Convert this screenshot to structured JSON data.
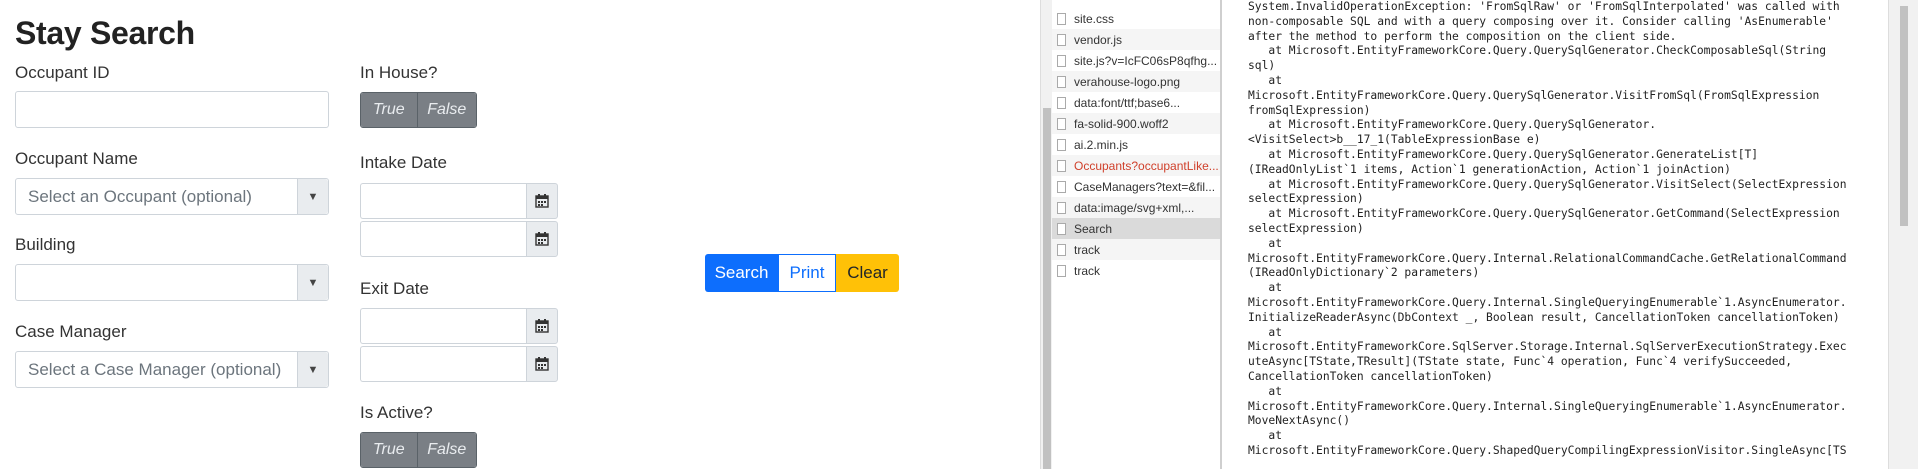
{
  "form": {
    "title": "Stay Search",
    "occupant_id": {
      "label": "Occupant ID",
      "value": ""
    },
    "occupant_name": {
      "label": "Occupant Name",
      "placeholder": "Select an Occupant (optional)"
    },
    "building": {
      "label": "Building",
      "value": ""
    },
    "case_manager": {
      "label": "Case Manager",
      "placeholder": "Select a Case Manager (optional)"
    },
    "in_house": {
      "label": "In House?",
      "true_label": "True",
      "false_label": "False"
    },
    "intake_date": {
      "label": "Intake Date",
      "from": "",
      "to": ""
    },
    "exit_date": {
      "label": "Exit Date",
      "from": "",
      "to": ""
    },
    "is_active": {
      "label": "Is Active?",
      "true_label": "True",
      "false_label": "False"
    },
    "buttons": {
      "search": "Search",
      "print": "Print",
      "clear": "Clear"
    }
  },
  "colors": {
    "primary": "#0d6efd",
    "warning": "#ffc107",
    "toggle_gray": "#7a7f85",
    "error_text": "#d0402b"
  },
  "network": {
    "requests": [
      {
        "name": "site.css"
      },
      {
        "name": "vendor.js"
      },
      {
        "name": "site.js?v=IcFC06sP8qfhg..."
      },
      {
        "name": "verahouse-logo.png"
      },
      {
        "name": "data:font/ttf;base6..."
      },
      {
        "name": "fa-solid-900.woff2"
      },
      {
        "name": "ai.2.min.js"
      },
      {
        "name": "Occupants?occupantLike..."
      },
      {
        "name": "CaseManagers?text=&fil..."
      },
      {
        "name": "data:image/svg+xml,..."
      },
      {
        "name": "Search"
      },
      {
        "name": "track"
      },
      {
        "name": "track"
      }
    ]
  },
  "console": {
    "lines": [
      "System.InvalidOperationException: 'FromSqlRaw' or 'FromSqlInterpolated' was called with",
      "non-composable SQL and with a query composing over it. Consider calling 'AsEnumerable'",
      "after the method to perform the composition on the client side.",
      "   at Microsoft.EntityFrameworkCore.Query.QuerySqlGenerator.CheckComposableSql(String",
      "sql)",
      "   at",
      "Microsoft.EntityFrameworkCore.Query.QuerySqlGenerator.VisitFromSql(FromSqlExpression",
      "fromSqlExpression)",
      "   at Microsoft.EntityFrameworkCore.Query.QuerySqlGenerator.",
      "<VisitSelect>b__17_1(TableExpressionBase e)",
      "   at Microsoft.EntityFrameworkCore.Query.QuerySqlGenerator.GenerateList[T]",
      "(IReadOnlyList`1 items, Action`1 generationAction, Action`1 joinAction)",
      "   at Microsoft.EntityFrameworkCore.Query.QuerySqlGenerator.VisitSelect(SelectExpression",
      "selectExpression)",
      "   at Microsoft.EntityFrameworkCore.Query.QuerySqlGenerator.GetCommand(SelectExpression",
      "selectExpression)",
      "   at",
      "Microsoft.EntityFrameworkCore.Query.Internal.RelationalCommandCache.GetRelationalCommand",
      "(IReadOnlyDictionary`2 parameters)",
      "   at",
      "Microsoft.EntityFrameworkCore.Query.Internal.SingleQueryingEnumerable`1.AsyncEnumerator.",
      "InitializeReaderAsync(DbContext _, Boolean result, CancellationToken cancellationToken)",
      "   at",
      "Microsoft.EntityFrameworkCore.SqlServer.Storage.Internal.SqlServerExecutionStrategy.Exec",
      "uteAsync[TState,TResult](TState state, Func`4 operation, Func`4 verifySucceeded,",
      "CancellationToken cancellationToken)",
      "   at",
      "Microsoft.EntityFrameworkCore.Query.Internal.SingleQueryingEnumerable`1.AsyncEnumerator.",
      "MoveNextAsync()",
      "   at",
      "Microsoft.EntityFrameworkCore.Query.ShapedQueryCompilingExpressionVisitor.SingleAsync[TS"
    ]
  }
}
